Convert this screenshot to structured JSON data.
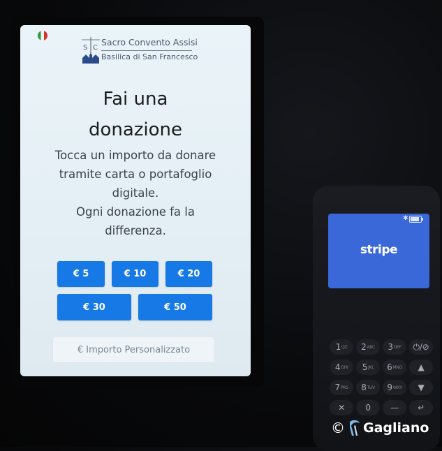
{
  "kiosk": {
    "logo": {
      "monogram": "SC",
      "line1": "Sacro Convento Assisi",
      "line2": "Basilica di San Francesco"
    },
    "language_flag": "flag-italy-icon",
    "title_lines": [
      "Fai una",
      "donazione"
    ],
    "subtitle_lines": [
      "Tocca un importo da donare",
      "tramite carta o portafoglio",
      "digitale.",
      "Ogni donazione fa la",
      "differenza."
    ],
    "amounts": [
      "€ 5",
      "€ 10",
      "€ 20",
      "€ 30",
      "€ 50"
    ],
    "custom_amount_placeholder": "€ Importo Personalizzato",
    "accent_color": "#1679e6"
  },
  "terminal": {
    "brand": "stripe",
    "screen_color": "#3a68d9",
    "keys": [
      {
        "main": "1",
        "sub": "QZ"
      },
      {
        "main": "2",
        "sub": "ABC"
      },
      {
        "main": "3",
        "sub": "DEF"
      },
      {
        "main": "⏻/⊘",
        "sub": ""
      },
      {
        "main": "4",
        "sub": "GHI"
      },
      {
        "main": "5",
        "sub": "JKL"
      },
      {
        "main": "6",
        "sub": "MNO"
      },
      {
        "main": "▲",
        "sub": ""
      },
      {
        "main": "7",
        "sub": "PRS"
      },
      {
        "main": "8",
        "sub": "TUV"
      },
      {
        "main": "9",
        "sub": "WXY"
      },
      {
        "main": "▼",
        "sub": ""
      },
      {
        "main": "✕",
        "sub": ""
      },
      {
        "main": "0",
        "sub": ""
      },
      {
        "main": "—",
        "sub": ""
      },
      {
        "main": "↵",
        "sub": ""
      }
    ]
  },
  "watermark": {
    "copyright": "©",
    "name": "Gagliano"
  }
}
